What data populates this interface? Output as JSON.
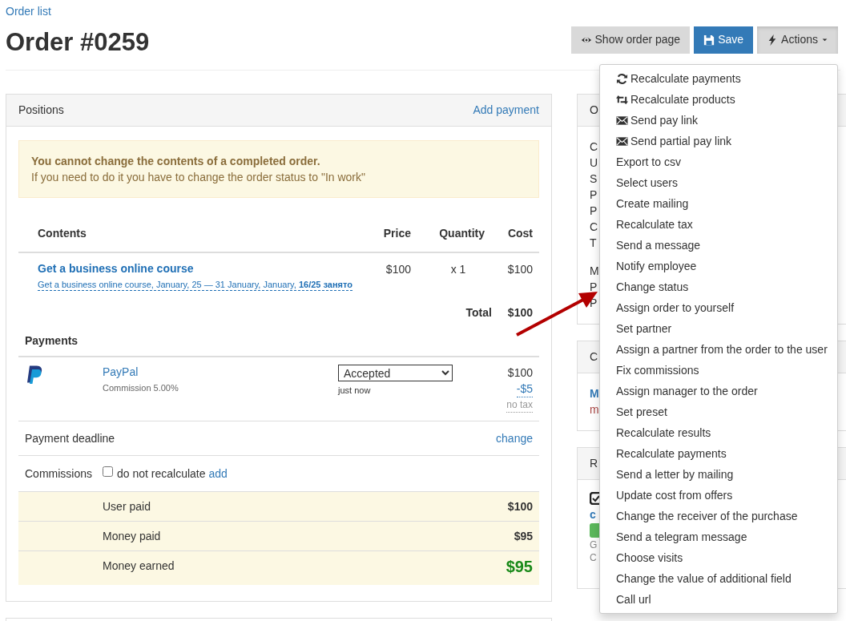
{
  "breadcrumb": "Order list",
  "title": "Order #0259",
  "buttons": [
    {
      "label": "Show order page",
      "kind": "default"
    },
    {
      "label": "Save",
      "kind": "primary"
    },
    {
      "label": "Actions",
      "kind": "dropdown"
    }
  ],
  "positions": {
    "title": "Positions",
    "link": "Add payment",
    "alert": {
      "title": "You cannot change the contents of a completed order.",
      "text": "If you need to do it you have to change the order status to \"In work\""
    },
    "columns": [
      "Contents",
      "Price",
      "Quantity",
      "Cost"
    ],
    "rows": [
      {
        "name": "Get a business online course",
        "detail": "Get a business online course, January, 25 — 31 January, January, **16/25 занято**",
        "price": "$100",
        "quantity": "x 1",
        "cost": "$100"
      }
    ],
    "total_label": "Total",
    "total": "$100"
  },
  "payments": {
    "title": "Payments",
    "items": [
      {
        "method": "PayPal",
        "commission": "Commission 5.00%",
        "status": "Accepted",
        "time": "just now",
        "amount": "$100",
        "fee": "-$5",
        "tax": "no tax"
      }
    ]
  },
  "deadline": {
    "label": "Payment deadline",
    "link": "change"
  },
  "commissions": {
    "label": "Commissions",
    "checkbox": {
      "label": "do not recalculate",
      "checked": false
    },
    "link": "add"
  },
  "summary": [
    {
      "label": "User paid",
      "value": "$100",
      "kind": "plain"
    },
    {
      "label": "Money paid",
      "value": "$95",
      "kind": "plain"
    },
    {
      "label": "Money earned",
      "value": "$95",
      "kind": "highlight"
    }
  ],
  "side_cards": [
    {
      "header": "O",
      "groups": [
        [
          {
            "kind": "text",
            "text": "C"
          },
          {
            "kind": "text",
            "text": "U"
          },
          {
            "kind": "text",
            "text": "S"
          },
          {
            "kind": "text",
            "text": "P"
          },
          {
            "kind": "text",
            "text": "P"
          },
          {
            "kind": "text",
            "text": "C"
          },
          {
            "kind": "text",
            "text": "T"
          }
        ],
        [
          {
            "kind": "text",
            "text": "M"
          },
          {
            "kind": "text",
            "text": "P"
          },
          {
            "kind": "text",
            "text": "P"
          }
        ]
      ]
    },
    {
      "header": "C",
      "groups": [
        [
          {
            "kind": "link",
            "text": "M"
          },
          {
            "kind": "accent",
            "text": "m"
          }
        ]
      ]
    },
    {
      "header": "R",
      "groups": [
        [
          {
            "kind": "icon"
          },
          {
            "kind": "link",
            "text": "c"
          },
          {
            "kind": "badge"
          },
          {
            "kind": "muted",
            "text": "G"
          },
          {
            "kind": "muted",
            "text": "C"
          }
        ]
      ]
    }
  ],
  "menu": {
    "items": [
      {
        "label": "Recalculate payments"
      },
      {
        "label": "Recalculate products"
      },
      {
        "label": "Send pay link"
      },
      {
        "label": "Send partial pay link"
      },
      {
        "label": "Export to csv"
      },
      {
        "label": "Select users"
      },
      {
        "label": "Create mailing"
      },
      {
        "label": "Recalculate tax"
      },
      {
        "label": "Send a message"
      },
      {
        "label": "Notify employee"
      },
      {
        "label": "Change status"
      },
      {
        "label": "Assign order to yourself"
      },
      {
        "label": "Set partner"
      },
      {
        "label": "Assign a partner from the order to the user"
      },
      {
        "label": "Fix commissions"
      },
      {
        "label": "Assign manager to the order"
      },
      {
        "label": "Set preset"
      },
      {
        "label": "Recalculate results"
      },
      {
        "label": "Recalculate payments"
      },
      {
        "label": "Send a letter by mailing"
      },
      {
        "label": "Update cost from offers"
      },
      {
        "label": "Change the receiver of the purchase"
      },
      {
        "label": "Send a telegram message"
      },
      {
        "label": "Choose visits"
      },
      {
        "label": "Change the value of additional field"
      },
      {
        "label": "Call url"
      }
    ]
  }
}
